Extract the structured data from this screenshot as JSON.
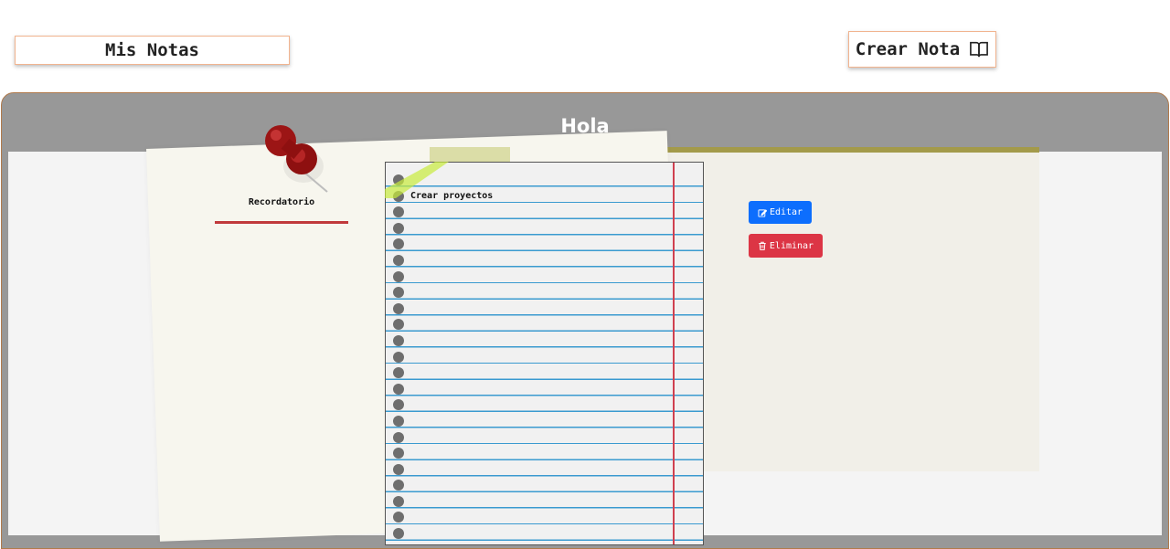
{
  "nav": {
    "mis_notas_label": "Mis Notas",
    "crear_nota_label": "Crear Nota",
    "crear_nota_icon": "book-open-icon"
  },
  "note": {
    "title": "Hola",
    "category": "Recordatorio",
    "tasks": [
      "Crear proyectos"
    ],
    "pin_icon": "push-pin-icon"
  },
  "actions": {
    "edit_label": "Editar",
    "edit_icon": "pencil-square-icon",
    "delete_label": "Eliminar",
    "delete_icon": "trash-icon"
  },
  "colors": {
    "accent_border": "#f1b48f",
    "panel_bg": "#989898",
    "edit_button": "#0d6efd",
    "delete_button": "#dc3545",
    "notebook_rule": "#3a9ad0",
    "notebook_margin": "#d04050",
    "category_underline": "#c0393b"
  }
}
